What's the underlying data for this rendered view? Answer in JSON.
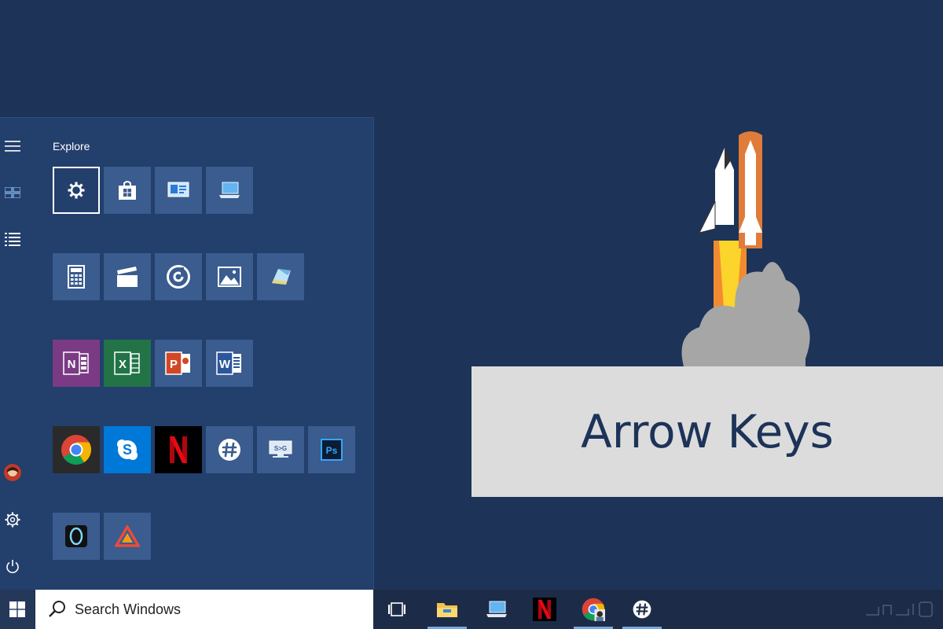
{
  "start_menu": {
    "group_title": "Explore",
    "rail": [
      {
        "name": "hamburger-menu-icon"
      },
      {
        "name": "tiles-view-icon"
      },
      {
        "name": "all-apps-list-icon"
      },
      {
        "name": "user-avatar-icon"
      },
      {
        "name": "settings-gear-icon"
      },
      {
        "name": "power-icon"
      }
    ],
    "tiles": [
      {
        "name": "settings-tile",
        "icon": "gear-icon",
        "color": "#233f6c",
        "selected": true
      },
      {
        "name": "store-tile",
        "icon": "store-bag-icon",
        "color": "#3a5c8e"
      },
      {
        "name": "contact-tile",
        "icon": "contact-card-icon",
        "color": "#3a5c8e"
      },
      {
        "name": "connect-tile",
        "icon": "laptop-icon",
        "color": "#3a5c8e"
      },
      {
        "name": "calculator-tile",
        "icon": "calculator-icon",
        "color": "#3a5c8e"
      },
      {
        "name": "movies-tile",
        "icon": "clapperboard-icon",
        "color": "#3a5c8e"
      },
      {
        "name": "groove-music-tile",
        "icon": "music-disc-icon",
        "color": "#3a5c8e"
      },
      {
        "name": "photos-tile",
        "icon": "photo-icon",
        "color": "#3a5c8e"
      },
      {
        "name": "maps-tile",
        "icon": "map-icon",
        "color": "#3a5c8e"
      },
      {
        "name": "onenote-tile",
        "icon": "onenote-icon",
        "color": "#7b3a84"
      },
      {
        "name": "excel-tile",
        "icon": "excel-icon",
        "color": "#227447"
      },
      {
        "name": "powerpoint-tile",
        "icon": "powerpoint-icon",
        "color": "#3a5c8e"
      },
      {
        "name": "word-tile",
        "icon": "word-icon",
        "color": "#3a5c8e"
      },
      {
        "name": "chrome-tile",
        "icon": "chrome-icon",
        "color": "#2a2a2a"
      },
      {
        "name": "skype-tile",
        "icon": "skype-icon",
        "color": "#0078d7"
      },
      {
        "name": "netflix-tile",
        "icon": "netflix-icon",
        "color": "#000000"
      },
      {
        "name": "slack-tile",
        "icon": "slack-icon",
        "color": "#3a5c8e"
      },
      {
        "name": "remote-tile",
        "icon": "remote-display-icon",
        "color": "#3a5c8e"
      },
      {
        "name": "photoshop-tile",
        "icon": "photoshop-icon",
        "color": "#3a5c8e"
      },
      {
        "name": "cortana-tile",
        "icon": "ring-icon",
        "color": "#3a5c8e"
      },
      {
        "name": "triangle-app-tile",
        "icon": "triangle-icon",
        "color": "#3a5c8e"
      }
    ]
  },
  "taskbar": {
    "search_placeholder": "Search Windows",
    "icons": [
      {
        "name": "task-view-icon"
      },
      {
        "name": "file-explorer-icon",
        "active": true
      },
      {
        "name": "this-pc-icon"
      },
      {
        "name": "netflix-icon"
      },
      {
        "name": "chrome-icon",
        "active": true
      },
      {
        "name": "slack-icon",
        "active": true
      }
    ]
  },
  "overlay": {
    "title": "Arrow Keys"
  }
}
